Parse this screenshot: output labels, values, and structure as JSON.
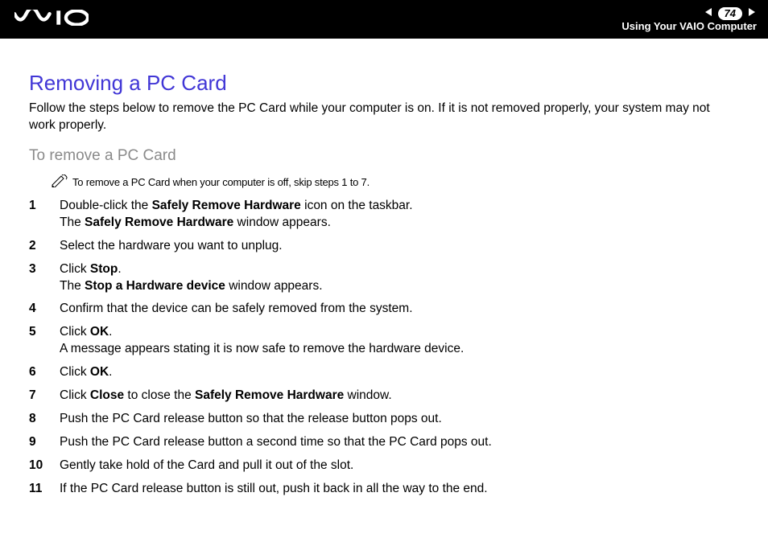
{
  "header": {
    "page_number": "74",
    "section_label": "Using Your VAIO Computer"
  },
  "title": "Removing a PC Card",
  "intro": "Follow the steps below to remove the PC Card while your computer is on. If it is not removed properly, your system may not work properly.",
  "subhead": "To remove a PC Card",
  "note": "To remove a PC Card when your computer is off, skip steps 1 to 7.",
  "steps": [
    {
      "n": "1",
      "html": "Double-click the <strong>Safely Remove Hardware</strong> icon on the taskbar.<br>The <strong>Safely Remove Hardware</strong> window appears."
    },
    {
      "n": "2",
      "html": "Select the hardware you want to unplug."
    },
    {
      "n": "3",
      "html": "Click <strong>Stop</strong>.<br>The <strong>Stop a Hardware device</strong> window appears."
    },
    {
      "n": "4",
      "html": "Confirm that the device can be safely removed from the system."
    },
    {
      "n": "5",
      "html": "Click <strong>OK</strong>.<br>A message appears stating it is now safe to remove the hardware device."
    },
    {
      "n": "6",
      "html": "Click <strong>OK</strong>."
    },
    {
      "n": "7",
      "html": "Click <strong>Close</strong> to close the <strong>Safely Remove Hardware</strong> window."
    },
    {
      "n": "8",
      "html": "Push the PC Card release button so that the release button pops out."
    },
    {
      "n": "9",
      "html": "Push the PC Card release button a second time so that the PC Card pops out."
    },
    {
      "n": "10",
      "html": "Gently take hold of the Card and pull it out of the slot."
    },
    {
      "n": "11",
      "html": "If the PC Card release button is still out, push it back in all the way to the end."
    }
  ]
}
